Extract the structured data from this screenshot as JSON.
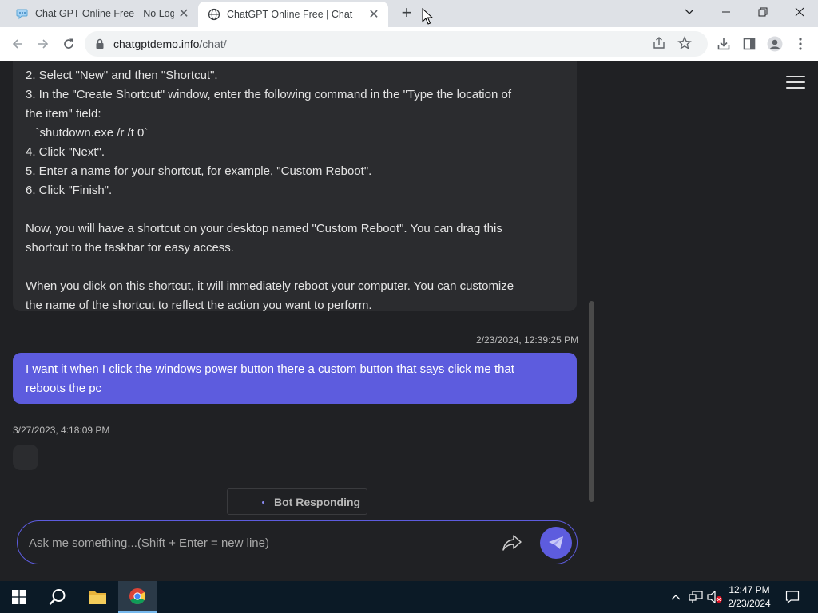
{
  "browser": {
    "tabs": [
      {
        "title": "Chat GPT Online Free - No Login",
        "active": false
      },
      {
        "title": "ChatGPT Online Free | Chat",
        "active": true
      }
    ],
    "new_tab_label": "+",
    "address": {
      "host": "chatgptdemo.info",
      "path": "/chat/"
    }
  },
  "chat": {
    "bot_message_lines": [
      "2. Select \"New\" and then \"Shortcut\".",
      "3. In the \"Create Shortcut\" window, enter the following command in the \"Type the location of",
      "the item\" field:",
      "   `shutdown.exe /r /t 0`",
      "4. Click \"Next\".",
      "5. Enter a name for your shortcut, for example, \"Custom Reboot\".",
      "6. Click \"Finish\".",
      "",
      "Now, you will have a shortcut on your desktop named \"Custom Reboot\". You can drag this",
      "shortcut to the taskbar for easy access.",
      "",
      "When you click on this shortcut, it will immediately reboot your computer. You can customize",
      "the name of the shortcut to reflect the action you want to perform."
    ],
    "user_timestamp": "2/23/2024, 12:39:25 PM",
    "user_message_lines": [
      "I want it when I click the windows power button there a custom button that says click me that",
      "reboots the pc"
    ],
    "bot_timestamp": "3/27/2023, 4:18:09 PM",
    "responding_label": "Bot Responding",
    "input_placeholder": "Ask me something...(Shift + Enter = new line)"
  },
  "taskbar": {
    "time": "12:47 PM",
    "date": "2/23/2024"
  },
  "colors": {
    "accent": "#5d5cde",
    "page_bg": "#202124",
    "bubble_bg": "#2b2c2f"
  }
}
